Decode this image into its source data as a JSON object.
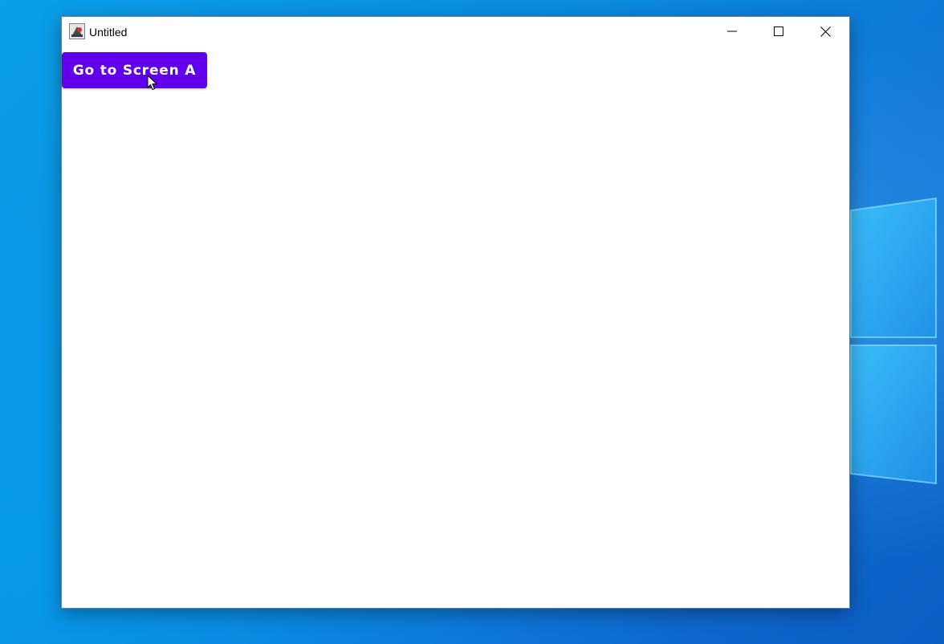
{
  "window": {
    "title": "Untitled",
    "app_icon": "java-app-icon",
    "controls": {
      "minimize_icon": "minimize-icon",
      "maximize_icon": "maximize-icon",
      "close_icon": "close-icon"
    }
  },
  "content": {
    "primary_button_label": "Go to Screen A",
    "primary_button_color": "#6200ee",
    "primary_button_text_color": "#ffffff"
  },
  "desktop": {
    "wallpaper": "windows-10-hero-wallpaper",
    "accent": "#0a8ee0"
  }
}
